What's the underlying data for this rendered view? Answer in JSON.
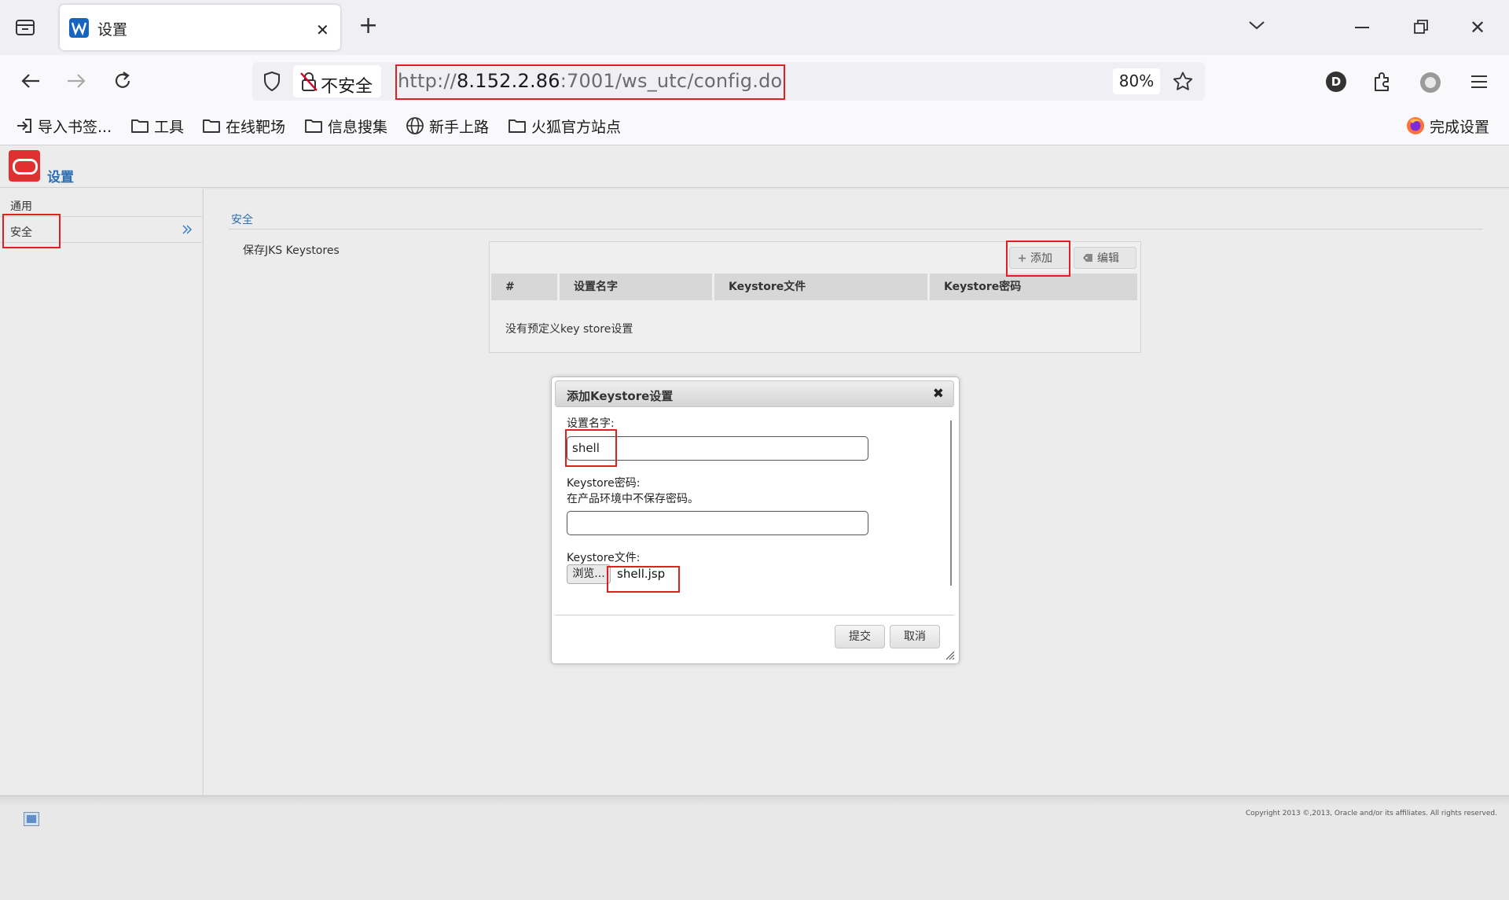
{
  "browser": {
    "tab": {
      "title": "设置"
    },
    "url": {
      "scheme": "http://",
      "host": "8.152.2.86",
      "rest": ":7001/ws_utc/config.do"
    },
    "security_label": "不安全",
    "zoom": "80%",
    "account_initial": "D",
    "bookmarks": [
      {
        "label": "导入书签...",
        "icon": "import-icon"
      },
      {
        "label": "工具",
        "icon": "folder-icon"
      },
      {
        "label": "在线靶场",
        "icon": "folder-icon"
      },
      {
        "label": "信息搜集",
        "icon": "folder-icon"
      },
      {
        "label": "新手上路",
        "icon": "globe-icon"
      },
      {
        "label": "火狐官方站点",
        "icon": "folder-icon"
      }
    ],
    "setup_label": "完成设置"
  },
  "app": {
    "title": "设置",
    "sidebar": [
      {
        "label": "通用"
      },
      {
        "label": "安全"
      }
    ],
    "section_title": "安全",
    "keystores_label": "保存JKS Keystores",
    "toolbar": {
      "add": "添加",
      "edit": "编辑"
    },
    "table": {
      "columns": [
        "#",
        "设置名字",
        "Keystore文件",
        "Keystore密码"
      ],
      "empty": "没有预定义key store设置"
    },
    "dialog": {
      "title": "添加Keystore设置",
      "close": "✖",
      "name_label": "设置名字:",
      "name_value": "shell",
      "password_label": "Keystore密码:",
      "password_hint": "在产品环境中不保存密码。",
      "password_value": "",
      "file_label": "Keystore文件:",
      "browse": "浏览...",
      "file_value": "shell.jsp",
      "submit": "提交",
      "cancel": "取消"
    },
    "copyright": "Copyright 2013 ©,2013, Oracle and/or its affiliates. All rights reserved."
  },
  "colors": {
    "annotation": "#e02020",
    "link_blue": "#2f6fb2",
    "oracle_red": "#e03030"
  }
}
